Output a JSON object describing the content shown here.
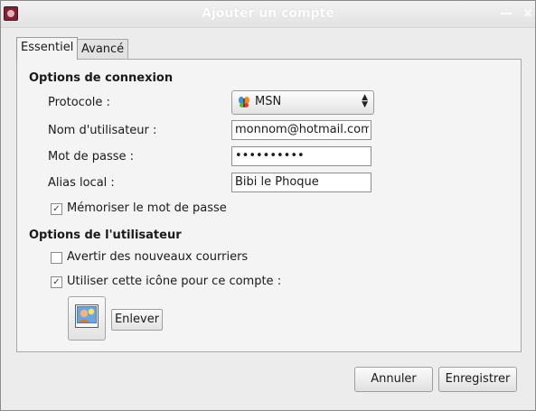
{
  "window": {
    "title": "Ajouter un compte",
    "minimize_glyph": "—",
    "close_glyph": "×"
  },
  "tabs": [
    {
      "label": "Essentiel",
      "active": true
    },
    {
      "label": "Avancé",
      "active": false
    }
  ],
  "connection": {
    "section_title": "Options de connexion",
    "protocol_label": "Protocole :",
    "protocol_value": "MSN",
    "protocol_icon": "msn-butterfly-icon",
    "username_label": "Nom d'utilisateur :",
    "username_value": "monnom@hotmail.com",
    "password_label": "Mot de passe :",
    "password_value": "••••••••••",
    "alias_label": "Alias local :",
    "alias_value": "Bibi le Phoque",
    "remember_label": "Mémoriser le mot de passe",
    "remember_checked": true
  },
  "user_options": {
    "section_title": "Options de l'utilisateur",
    "notify_label": "Avertir des nouveaux courriers",
    "notify_checked": false,
    "use_icon_label": "Utiliser cette icône pour ce compte :",
    "use_icon_checked": true,
    "buddy_icon": "user-picture-icon",
    "remove_label": "Enlever"
  },
  "buttons": {
    "cancel_label": "Annuler",
    "save_label": "Enregistrer"
  },
  "check_glyph": "✓"
}
